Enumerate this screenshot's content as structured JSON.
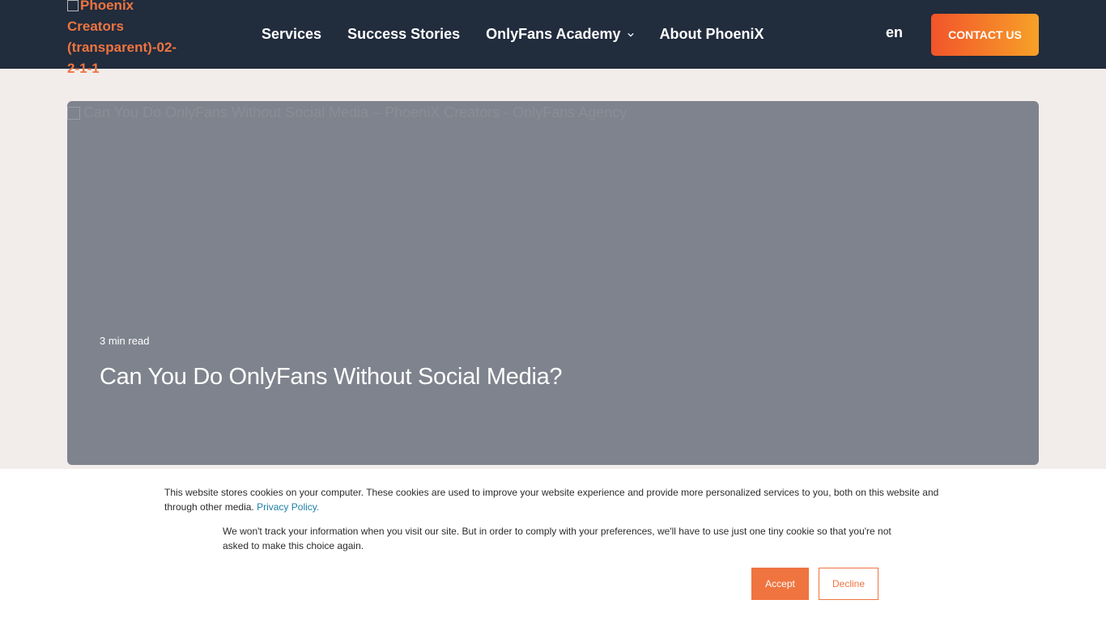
{
  "header": {
    "logo_alt": "Phoenix Creators (transparent)-02-2-1-1",
    "nav": [
      {
        "label": "Services"
      },
      {
        "label": "Success Stories"
      },
      {
        "label": "OnlyFans Academy",
        "has_dropdown": true
      },
      {
        "label": "About PhoeniX"
      }
    ],
    "language": "en",
    "contact_label": "CONTACT US"
  },
  "hero": {
    "image_alt": "Can You Do OnlyFans Without Social Media – PhoeniX Creators - OnlyFans Agency",
    "read_time": "3 min read",
    "title": "Can You Do OnlyFans Without Social Media?"
  },
  "cookie_banner": {
    "text1": "This website stores cookies on your computer. These cookies are used to improve your website experience and provide more personalized services to you, both on this website and through other media.",
    "privacy_link": "Privacy Policy.",
    "text2": "We won't track your information when you visit our site. But in order to comply with your preferences, we'll have to use just one tiny cookie so that you're not asked to make this choice again.",
    "accept_label": "Accept",
    "decline_label": "Decline"
  },
  "colors": {
    "header_bg": "#212c3d",
    "accent": "#ef7440",
    "page_bg": "#f2edeb",
    "hero_bg": "#7f838d"
  },
  "icons": [
    "broken-image-icon",
    "chevron-down-icon"
  ]
}
